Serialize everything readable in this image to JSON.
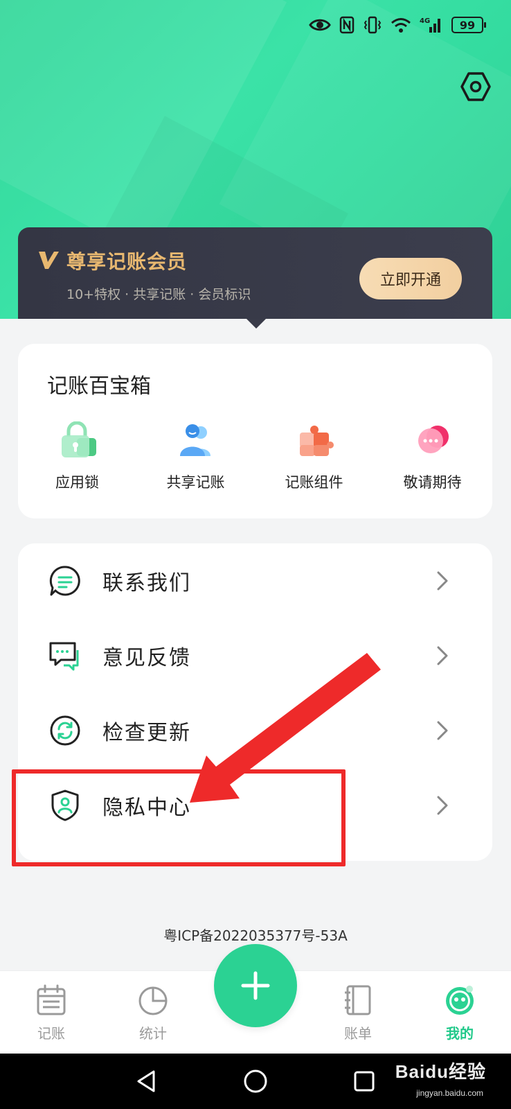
{
  "status_bar": {
    "battery_level": "99",
    "network": "4G",
    "icons": [
      "eye-icon",
      "nfc-icon",
      "vibrate-icon",
      "wifi-icon",
      "signal-icon",
      "battery-icon"
    ]
  },
  "header": {
    "settings_icon": "settings-hexagon-icon"
  },
  "vip_card": {
    "title": "尊享记账会员",
    "benefits": "10+特权 · 共享记账 · 会员标识",
    "button_label": "立即开通"
  },
  "toolbox": {
    "title": "记账百宝箱",
    "items": [
      {
        "label": "应用锁",
        "icon": "app-lock-icon"
      },
      {
        "label": "共享记账",
        "icon": "shared-bookkeeping-icon"
      },
      {
        "label": "记账组件",
        "icon": "widget-puzzle-icon"
      },
      {
        "label": "敬请期待",
        "icon": "coming-soon-chat-icon"
      }
    ]
  },
  "menu": {
    "items": [
      {
        "label": "联系我们",
        "icon": "chat-bubble-icon"
      },
      {
        "label": "意见反馈",
        "icon": "feedback-icon"
      },
      {
        "label": "检查更新",
        "icon": "refresh-icon"
      },
      {
        "label": "隐私中心",
        "icon": "privacy-shield-icon"
      }
    ]
  },
  "icp": "粤ICP备2022035377号-53A",
  "tabbar": {
    "items": [
      {
        "label": "记账",
        "icon": "calendar-icon",
        "active": false
      },
      {
        "label": "统计",
        "icon": "pie-chart-icon",
        "active": false
      },
      {
        "label": "账单",
        "icon": "notebook-icon",
        "active": false
      },
      {
        "label": "我的",
        "icon": "smiley-icon",
        "active": true
      }
    ],
    "fab_icon": "plus-icon"
  },
  "colors": {
    "brand_green": "#2bd293",
    "vip_gold": "#e8b870",
    "highlight_red": "#ee2a2a"
  },
  "watermark": {
    "text": "Baidu经验",
    "sub": "jingyan.baidu.com"
  }
}
